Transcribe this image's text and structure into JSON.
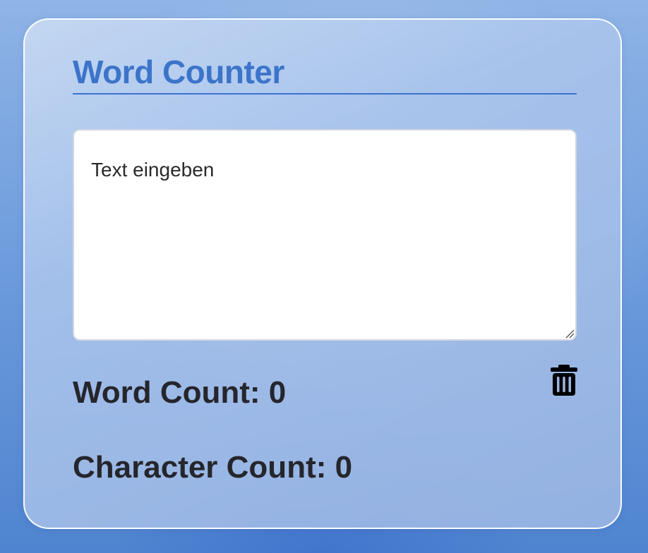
{
  "app": {
    "title": "Word Counter"
  },
  "editor": {
    "placeholder": "Text eingeben",
    "value": ""
  },
  "stats": {
    "word_label": "Word Count:",
    "word_value": "0",
    "char_label": "Character Count:",
    "char_value": "0"
  },
  "actions": {
    "clear_icon": "trash-icon"
  },
  "colors": {
    "title": "#3c74c9",
    "text": "#25262c",
    "card_border": "#ffffff"
  }
}
